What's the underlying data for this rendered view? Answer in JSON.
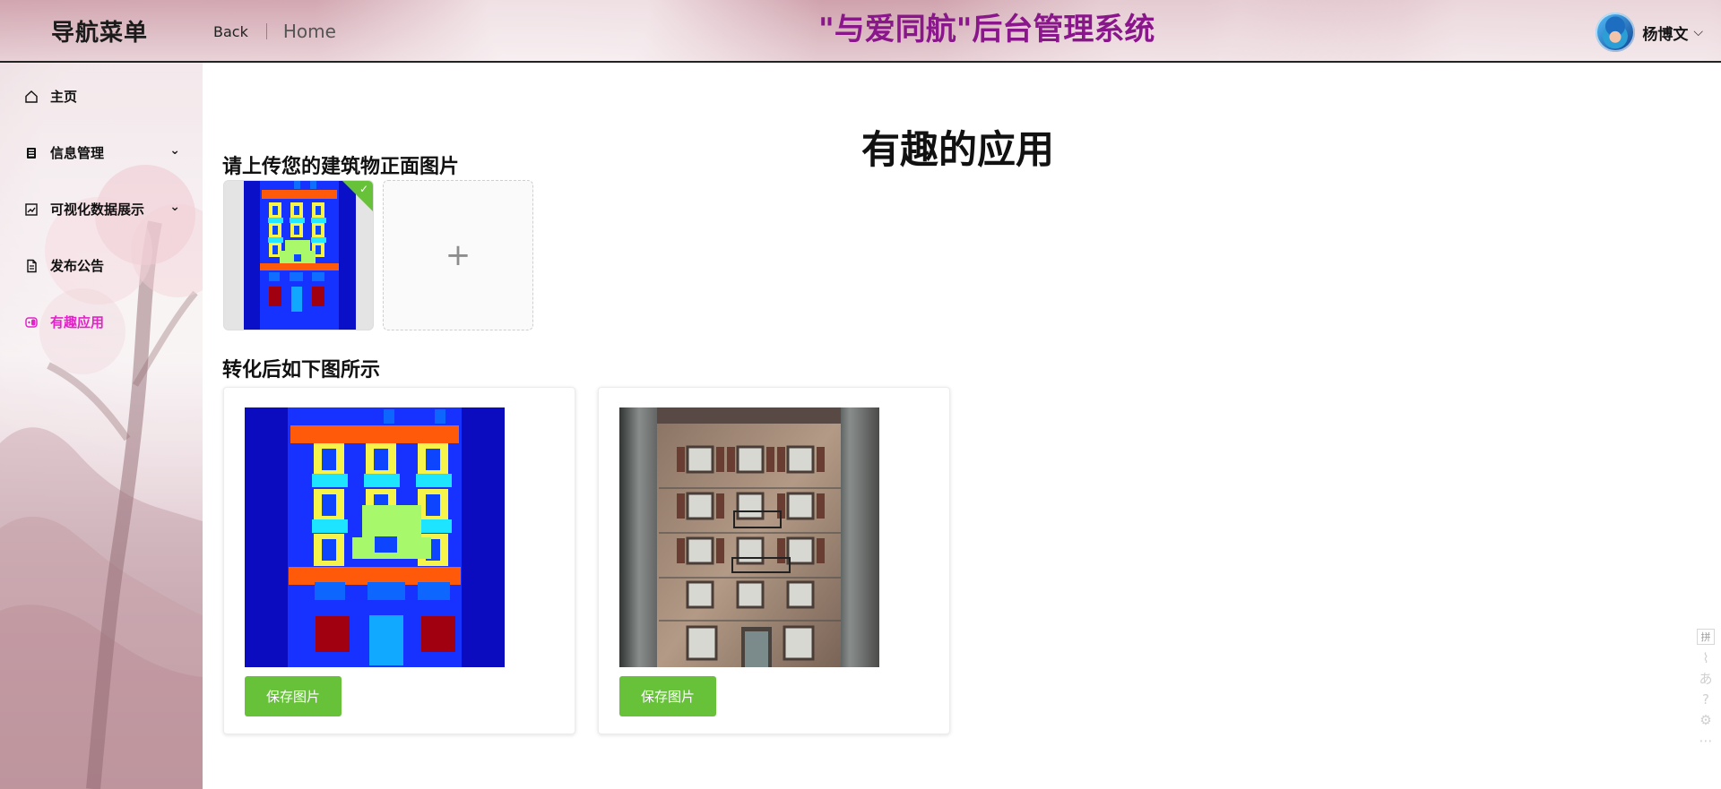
{
  "header": {
    "brand": "导航菜单",
    "back_label": "Back",
    "home_label": "Home",
    "system_title": "\"与爱同航\"后台管理系统",
    "user_name": "杨博文",
    "user_chevron": "⌵"
  },
  "sidebar": {
    "items": [
      {
        "label": "主页",
        "icon": "home-icon",
        "expandable": false,
        "active": false
      },
      {
        "label": "信息管理",
        "icon": "clipboard-icon",
        "expandable": true,
        "active": false
      },
      {
        "label": "可视化数据展示",
        "icon": "image-icon",
        "expandable": true,
        "active": false
      },
      {
        "label": "发布公告",
        "icon": "document-icon",
        "expandable": false,
        "active": false
      },
      {
        "label": "有趣应用",
        "icon": "switch-icon",
        "expandable": false,
        "active": true
      }
    ],
    "arrow": "⌄"
  },
  "main": {
    "page_title": "有趣的应用",
    "upload_title": "请上传您的建筑物正面图片",
    "result_title": "转化后如下图所示",
    "upload_plus": "+",
    "save_label": "保存图片"
  },
  "ime": {
    "key": "拼",
    "glyphs": [
      "⌇",
      "あ",
      "?",
      "⚙",
      "⋯"
    ]
  },
  "colors": {
    "accent": "#e024c7",
    "title": "#8a168b",
    "success": "#67c23a"
  }
}
